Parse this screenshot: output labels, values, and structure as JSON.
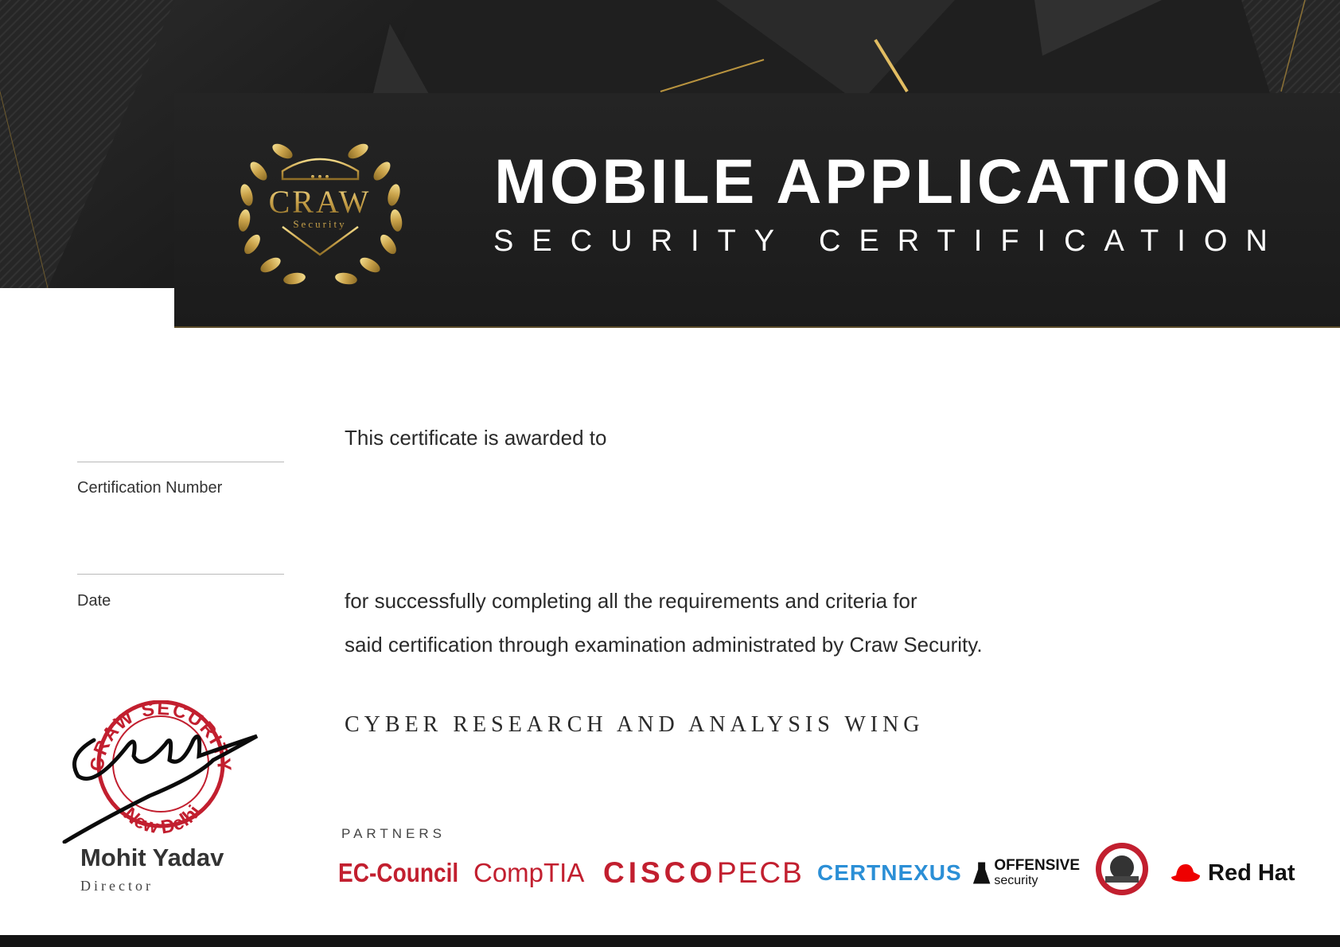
{
  "header": {
    "title": "MOBILE APPLICATION",
    "subtitle": "SECURITY CERTIFICATION",
    "logo_text": "CRAW",
    "logo_subtext": "Security"
  },
  "fields": {
    "certification_number_label": "Certification Number",
    "date_label": "Date"
  },
  "body": {
    "awarded_to": "This certificate is awarded to",
    "line1": "for successfully completing all the requirements and criteria for",
    "line2": "said certification through examination administrated by Craw Security.",
    "wing": "CYBER RESEARCH AND ANALYSIS WING"
  },
  "partners": {
    "label": "PARTNERS",
    "items": [
      "EC-Council",
      "CompTIA",
      "CISCO",
      "PECB",
      "CERTNEXUS",
      "OFFENSIVE",
      "security",
      "Red Hat"
    ]
  },
  "signature": {
    "name": "Mohit Yadav",
    "role": "Director",
    "stamp_text": "CRAW SECURITY",
    "stamp_city": "New Delhi"
  },
  "colors": {
    "gold": "#c9a24a",
    "dark": "#1d1d1d",
    "red": "#c21f2f",
    "blue": "#2b8fd6"
  }
}
